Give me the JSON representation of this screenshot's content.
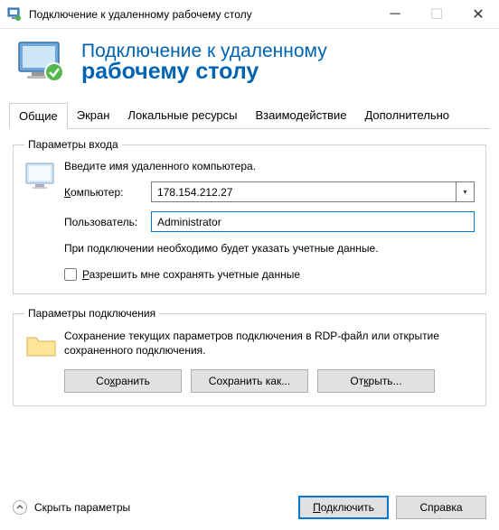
{
  "window": {
    "title": "Подключение к удаленному рабочему столу"
  },
  "header": {
    "line1": "Подключение к удаленному",
    "line2": "рабочему столу"
  },
  "tabs": {
    "general": "Общие",
    "screen": "Экран",
    "resources": "Локальные ресурсы",
    "interaction": "Взаимодействие",
    "advanced": "Дополнительно",
    "active": "general"
  },
  "login": {
    "legend": "Параметры входа",
    "instruction": "Введите имя удаленного компьютера.",
    "computer_accel": "К",
    "computer_label_rest": "омпьютер:",
    "computer_value": "178.154.212.27",
    "user_label": "Пользователь:",
    "user_value": "Administrator",
    "note": "При подключении необходимо будет указать учетные данные.",
    "save_accel": "Р",
    "save_label_rest": "азрешить мне сохранять учетные данные",
    "save_checked": false
  },
  "conn": {
    "legend": "Параметры подключения",
    "instruction": "Сохранение текущих параметров подключения в RDP-файл или открытие сохраненного подключения.",
    "save": "Со",
    "save_accel": "х",
    "save_rest": "ранить",
    "saveas": "Сохранить как...",
    "open_pre": "От",
    "open_accel": "к",
    "open_rest": "рыть..."
  },
  "bottom": {
    "hide_pre": "Скр",
    "hide_accel": "ы",
    "hide_rest": "ть параметры",
    "connect_accel": "П",
    "connect_rest": "одключить",
    "help": "Справка"
  }
}
